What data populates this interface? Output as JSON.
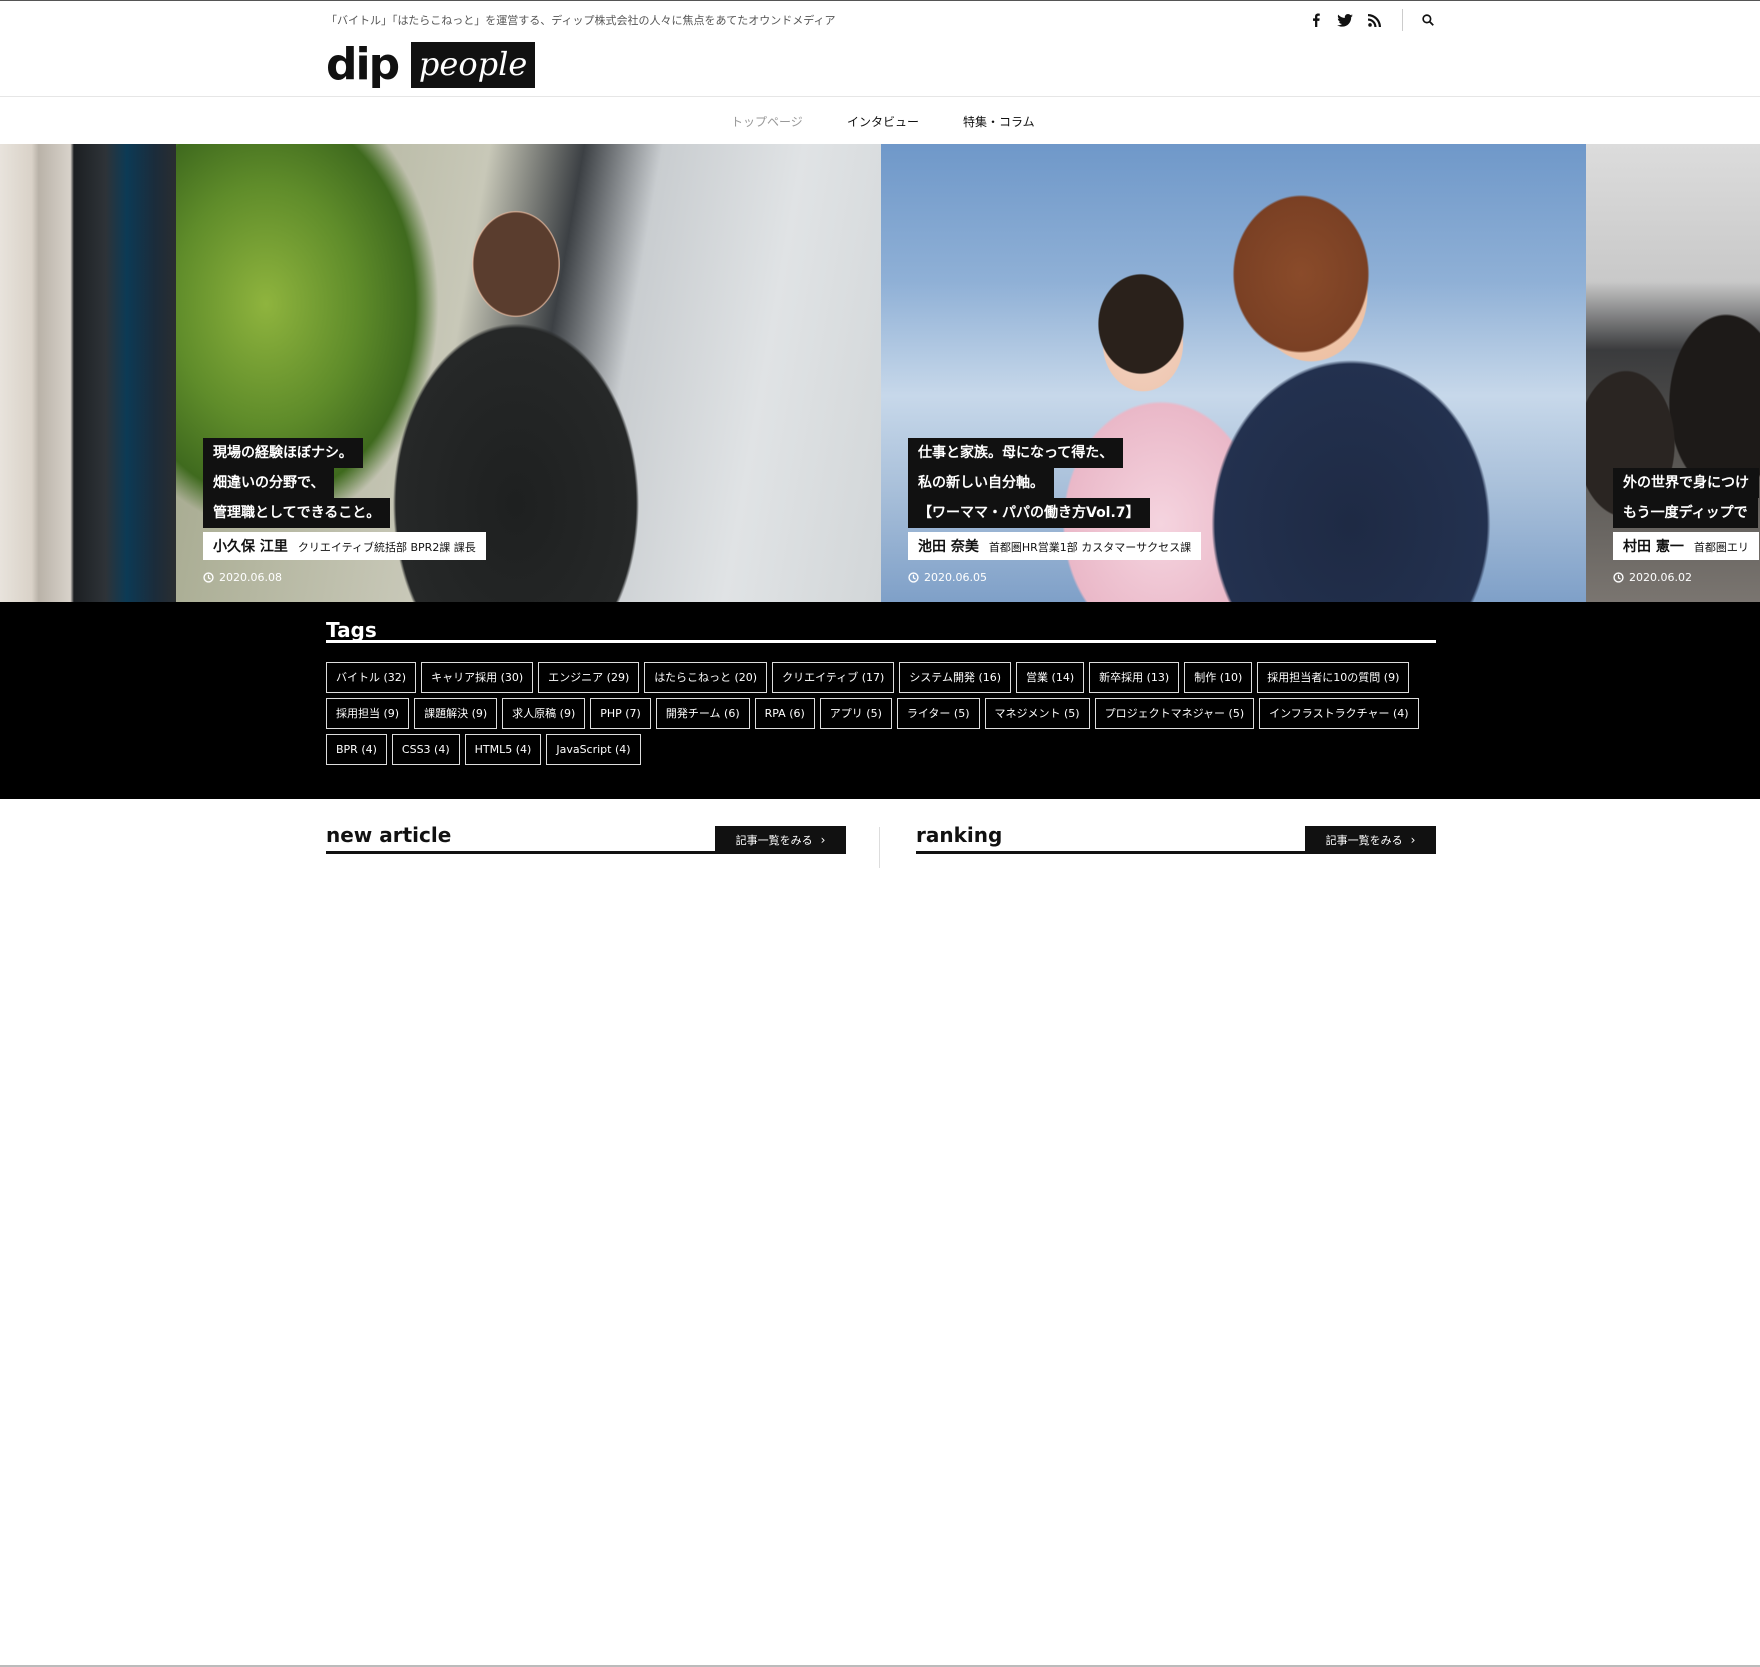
{
  "header": {
    "tagline": "「バイトル」「はたらこねっと」を運営する、ディップ株式会社の人々に焦点をあてたオウンドメディア",
    "logo_main": "dip",
    "logo_sub": "people",
    "social": [
      "facebook-icon",
      "twitter-icon",
      "rss-icon"
    ],
    "search_icon": "search-icon"
  },
  "nav": {
    "items": [
      {
        "label": "トップページ",
        "active": true
      },
      {
        "label": "インタビュー",
        "active": false
      },
      {
        "label": "特集・コラム",
        "active": false
      }
    ]
  },
  "slides": [
    {
      "lines": [
        "現場の経験ほぼナシ。",
        "畑違いの分野で、",
        "管理職としてできること。"
      ],
      "author_name": "小久保 江里",
      "author_dept": "クリエイティブ統括部 BPR2課 課長",
      "date": "2020.06.08"
    },
    {
      "lines": [
        "仕事と家族。母になって得た、",
        "私の新しい自分軸。",
        "【ワーママ・パパの働き方Vol.7】"
      ],
      "author_name": "池田 奈美",
      "author_dept": "首都圏HR営業1部 カスタマーサクセス課",
      "date": "2020.06.05"
    },
    {
      "lines": [
        "外の世界で身につけ",
        "もう一度ディップで"
      ],
      "author_name": "村田 憲一",
      "author_dept": "首都圏エリ",
      "date": "2020.06.02"
    }
  ],
  "tags": {
    "title": "Tags",
    "items": [
      "バイトル (32)",
      "キャリア採用 (30)",
      "エンジニア (29)",
      "はたらこねっと (20)",
      "クリエイティブ (17)",
      "システム開発 (16)",
      "営業 (14)",
      "新卒採用 (13)",
      "制作 (10)",
      "採用担当者に10の質問 (9)",
      "採用担当 (9)",
      "課題解決 (9)",
      "求人原稿 (9)",
      "PHP (7)",
      "開発チーム (6)",
      "RPA (6)",
      "アプリ (5)",
      "ライター (5)",
      "マネジメント (5)",
      "プロジェクトマネジャー (5)",
      "インフラストラクチャー (4)",
      "BPR (4)",
      "CSS3 (4)",
      "HTML5 (4)",
      "JavaScript (4)"
    ]
  },
  "sections": {
    "new_article": {
      "title": "new article",
      "more": "記事一覧をみる"
    },
    "ranking": {
      "title": "ranking",
      "more": "記事一覧をみる"
    }
  },
  "colors": {
    "black": "#111111",
    "tags_bg": "#000000",
    "nav_active": "#999999"
  }
}
